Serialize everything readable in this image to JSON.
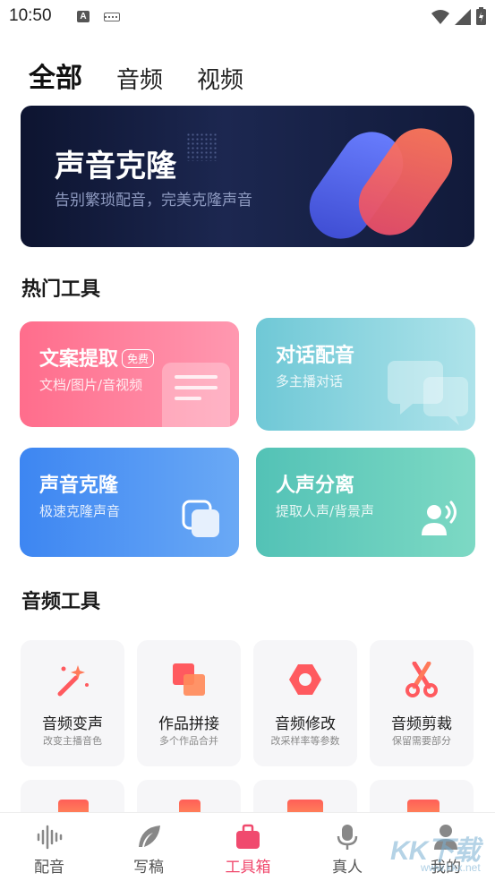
{
  "status_bar": {
    "time": "10:50",
    "icons": [
      "a-notification-icon",
      "keyboard-icon",
      "wifi-icon",
      "signal-icon",
      "battery-icon"
    ]
  },
  "tabs": [
    {
      "label": "全部",
      "active": true
    },
    {
      "label": "音频",
      "active": false
    },
    {
      "label": "视频",
      "active": false
    }
  ],
  "banner": {
    "title": "声音克隆",
    "subtitle": "告别繁琐配音，完美克隆声音"
  },
  "hot_tools": {
    "title": "热门工具",
    "items": [
      {
        "title": "文案提取",
        "tag": "免费",
        "subtitle": "文档/图片/音视频",
        "icon": "document-icon",
        "color": "#ff6d8c"
      },
      {
        "title": "对话配音",
        "subtitle": "多主播对话",
        "icon": "chat-bubbles-icon",
        "color": "#6fc8d6"
      },
      {
        "title": "声音克隆",
        "subtitle": "极速克隆声音",
        "icon": "copy-icon",
        "color": "#3d86f2"
      },
      {
        "title": "人声分离",
        "subtitle": "提取人声/背景声",
        "icon": "voice-person-icon",
        "color": "#53c2b6"
      }
    ]
  },
  "audio_tools": {
    "title": "音频工具",
    "items": [
      {
        "name": "音频变声",
        "desc": "改变主播音色",
        "icon": "magic-wand-icon"
      },
      {
        "name": "作品拼接",
        "desc": "多个作品合并",
        "icon": "stack-icon"
      },
      {
        "name": "音频修改",
        "desc": "改采样率等参数",
        "icon": "hexagon-nut-icon"
      },
      {
        "name": "音频剪裁",
        "desc": "保留需要部分",
        "icon": "scissors-icon"
      }
    ]
  },
  "bottom_nav": [
    {
      "label": "配音",
      "icon": "waveform-icon",
      "active": false
    },
    {
      "label": "写稿",
      "icon": "feather-icon",
      "active": false
    },
    {
      "label": "工具箱",
      "icon": "toolbox-icon",
      "active": true
    },
    {
      "label": "真人",
      "icon": "microphone-icon",
      "active": false
    },
    {
      "label": "我的",
      "icon": "user-icon",
      "active": false
    }
  ],
  "watermark": {
    "text": "KK下载",
    "sub": "www.kkx.net"
  },
  "colors": {
    "accent": "#f04a6e",
    "banner_bg": "#111a3a"
  }
}
